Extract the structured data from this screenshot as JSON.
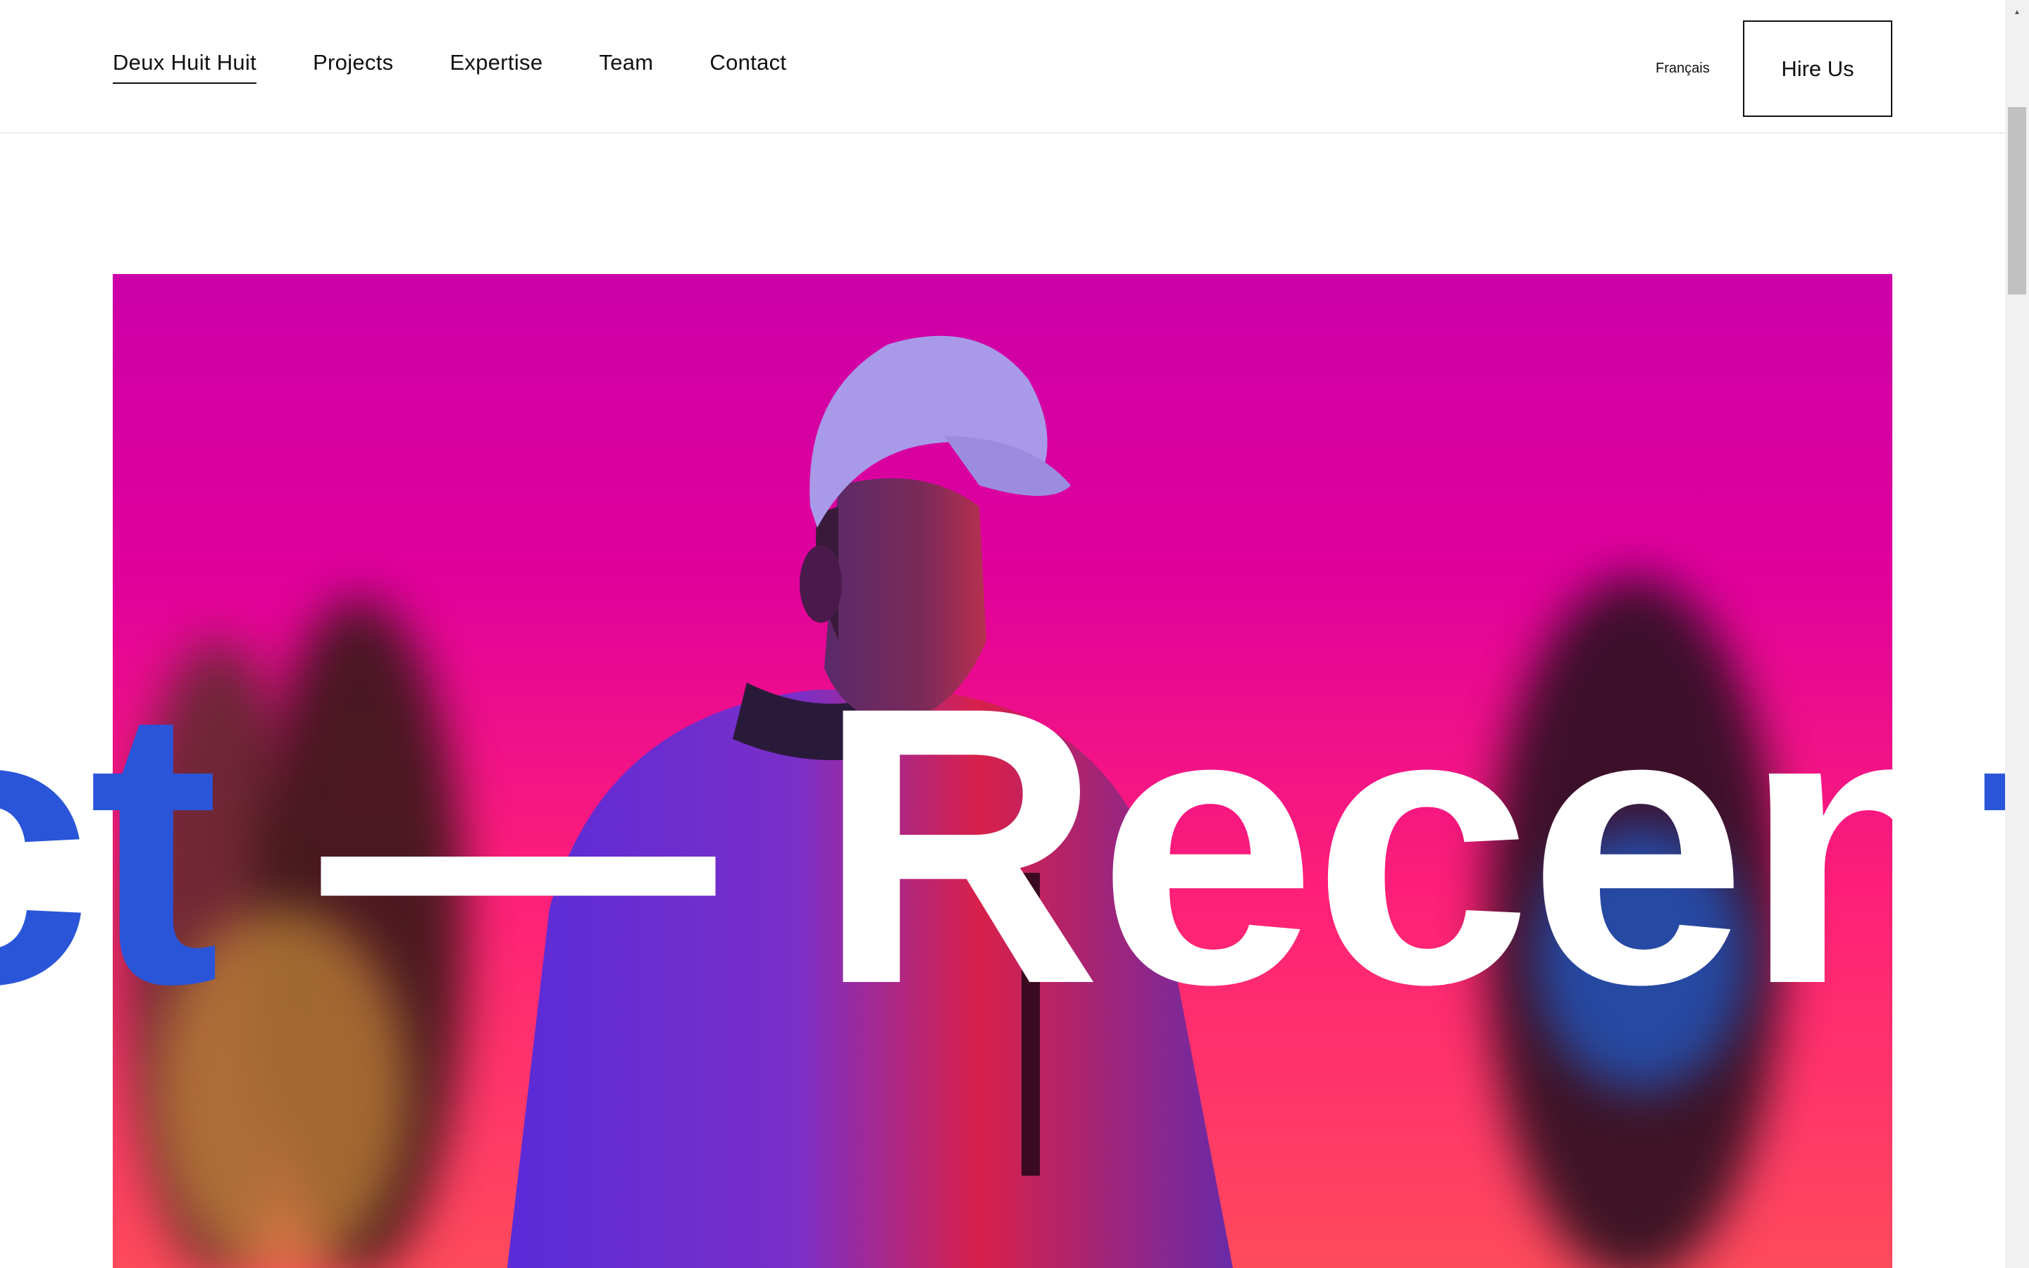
{
  "header": {
    "nav": [
      {
        "label": "Deux Huit Huit",
        "active": true
      },
      {
        "label": "Projects",
        "active": false
      },
      {
        "label": "Expertise",
        "active": false
      },
      {
        "label": "Team",
        "active": false
      },
      {
        "label": "Contact",
        "active": false
      }
    ],
    "language_label": "Français",
    "hire_label": "Hire Us"
  },
  "hero": {
    "marquee_left": "ct",
    "marquee_dash": " — ",
    "marquee_main": "Recen",
    "marquee_right": "t",
    "colors": {
      "text_white": "#ffffff",
      "text_blue": "#2a55d8",
      "bg_top": "#cc00a8",
      "bg_bottom": "#ff4a5c"
    }
  }
}
